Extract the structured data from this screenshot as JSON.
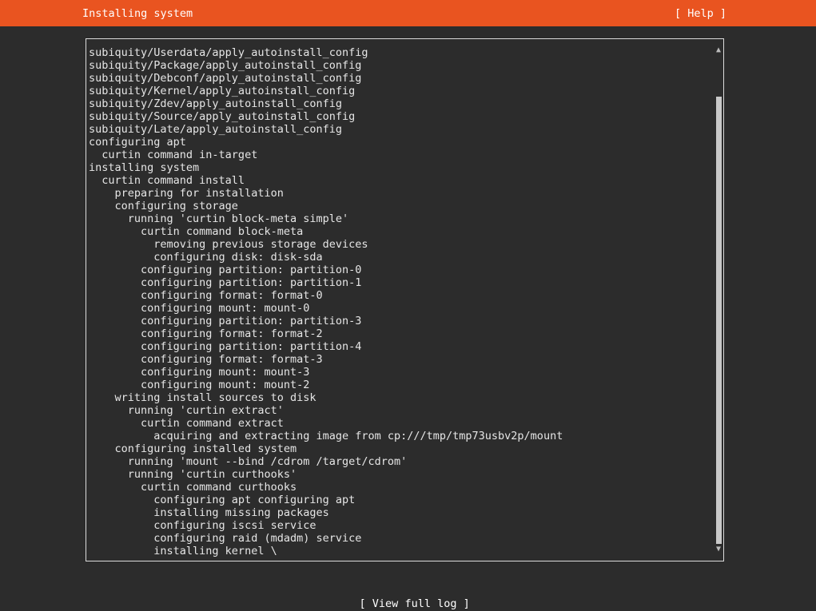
{
  "header": {
    "title": "Installing system",
    "help_label": "[ Help ]"
  },
  "log": {
    "lines": [
      "subiquity/Userdata/apply_autoinstall_config",
      "subiquity/Package/apply_autoinstall_config",
      "subiquity/Debconf/apply_autoinstall_config",
      "subiquity/Kernel/apply_autoinstall_config",
      "subiquity/Zdev/apply_autoinstall_config",
      "subiquity/Source/apply_autoinstall_config",
      "subiquity/Late/apply_autoinstall_config",
      "configuring apt",
      "  curtin command in-target",
      "installing system",
      "  curtin command install",
      "    preparing for installation",
      "    configuring storage",
      "      running 'curtin block-meta simple'",
      "        curtin command block-meta",
      "          removing previous storage devices",
      "          configuring disk: disk-sda",
      "        configuring partition: partition-0",
      "        configuring partition: partition-1",
      "        configuring format: format-0",
      "        configuring mount: mount-0",
      "        configuring partition: partition-3",
      "        configuring format: format-2",
      "        configuring partition: partition-4",
      "        configuring format: format-3",
      "        configuring mount: mount-3",
      "        configuring mount: mount-2",
      "    writing install sources to disk",
      "      running 'curtin extract'",
      "        curtin command extract",
      "          acquiring and extracting image from cp:///tmp/tmp73usbv2p/mount",
      "    configuring installed system",
      "      running 'mount --bind /cdrom /target/cdrom'",
      "      running 'curtin curthooks'",
      "        curtin command curthooks",
      "          configuring apt configuring apt",
      "          installing missing packages",
      "          configuring iscsi service",
      "          configuring raid (mdadm) service",
      "          installing kernel \\"
    ]
  },
  "scrollbar": {
    "up_icon": "▲",
    "down_icon": "▼"
  },
  "footer": {
    "view_log_label": "[ View full log ]"
  },
  "colors": {
    "header_bg": "#e95420",
    "page_bg": "#2c2c2c",
    "text": "#e6e6e6"
  }
}
